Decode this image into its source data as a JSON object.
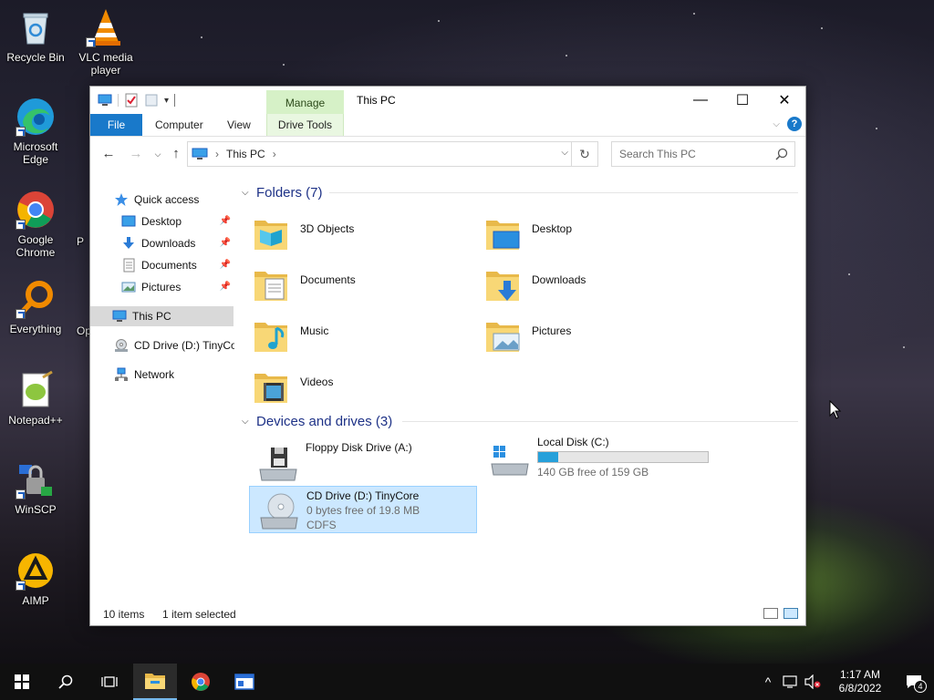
{
  "desktop": {
    "icons": [
      {
        "label": "Recycle Bin",
        "icon": "recycle-bin-icon"
      },
      {
        "label": "VLC media player",
        "icon": "vlc-icon"
      },
      {
        "label": "Microsoft Edge",
        "icon": "edge-icon"
      },
      {
        "label": "Google Chrome",
        "icon": "chrome-icon"
      },
      {
        "label": "Everything",
        "icon": "everything-icon"
      },
      {
        "label": "Notepad++",
        "icon": "notepadpp-icon"
      },
      {
        "label": "WinSCP",
        "icon": "winscp-icon"
      },
      {
        "label": "AIMP",
        "icon": "aimp-icon"
      }
    ],
    "partial_labels": [
      "P",
      "Op"
    ]
  },
  "window": {
    "title": "This PC",
    "contextual_tab": "Manage",
    "controls": {
      "minimize": "—",
      "maximize": "☐",
      "close": "✕"
    }
  },
  "ribbon": {
    "tabs": [
      {
        "label": "File"
      },
      {
        "label": "Computer"
      },
      {
        "label": "View"
      },
      {
        "label": "Drive Tools"
      }
    ],
    "help": "?"
  },
  "address": {
    "crumbs": [
      "This PC"
    ],
    "search_placeholder": "Search This PC"
  },
  "navpane": {
    "quick_access": "Quick access",
    "quick_items": [
      {
        "label": "Desktop",
        "icon": "desktop-icon"
      },
      {
        "label": "Downloads",
        "icon": "downloads-icon"
      },
      {
        "label": "Documents",
        "icon": "documents-icon"
      },
      {
        "label": "Pictures",
        "icon": "pictures-icon"
      }
    ],
    "this_pc": "This PC",
    "cd_drive": "CD Drive (D:) TinyCore",
    "network": "Network"
  },
  "content": {
    "folders_header": "Folders (7)",
    "folders": [
      {
        "label": "3D Objects",
        "icon": "3d-objects-icon"
      },
      {
        "label": "Desktop",
        "icon": "desktop-folder-icon"
      },
      {
        "label": "Documents",
        "icon": "documents-folder-icon"
      },
      {
        "label": "Downloads",
        "icon": "downloads-folder-icon"
      },
      {
        "label": "Music",
        "icon": "music-folder-icon"
      },
      {
        "label": "Pictures",
        "icon": "pictures-folder-icon"
      },
      {
        "label": "Videos",
        "icon": "videos-folder-icon"
      }
    ],
    "devices_header": "Devices and drives (3)",
    "drives": [
      {
        "name": "Floppy Disk Drive (A:)",
        "sub": "",
        "sub2": "",
        "icon": "floppy-drive-icon"
      },
      {
        "name": "Local Disk (C:)",
        "sub": "140 GB free of 159 GB",
        "sub2": "",
        "used_fraction": 0.12,
        "icon": "local-disk-icon"
      },
      {
        "name": "CD Drive (D:) TinyCore",
        "sub": "0 bytes free of 19.8 MB",
        "sub2": "CDFS",
        "icon": "cd-drive-icon"
      }
    ]
  },
  "status": {
    "items": "10 items",
    "selected": "1 item selected"
  },
  "taskbar": {
    "time": "1:17 AM",
    "date": "6/8/2022",
    "notification_count": "4"
  },
  "colors": {
    "accent": "#1979ca",
    "manage_tab": "#d6f1c7",
    "selection": "#cce8ff",
    "group_header": "#1e3287",
    "capacity_bar": "#26a0da"
  }
}
